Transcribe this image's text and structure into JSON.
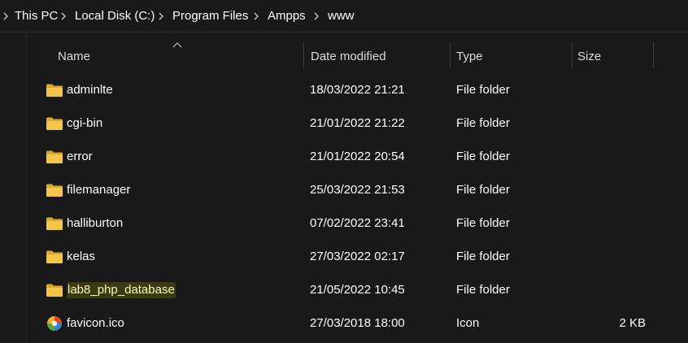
{
  "breadcrumb": {
    "items": [
      "This PC",
      "Local Disk (C:)",
      "Program Files",
      "Ampps",
      "www"
    ]
  },
  "columns": {
    "name": "Name",
    "date_modified": "Date modified",
    "type": "Type",
    "size": "Size",
    "sort_indicator": "sort-ascending-icon"
  },
  "files": [
    {
      "name": "adminlte",
      "date": "18/03/2022 21:21",
      "type": "File folder",
      "size": "",
      "icon": "folder-icon"
    },
    {
      "name": "cgi-bin",
      "date": "21/01/2022 21:22",
      "type": "File folder",
      "size": "",
      "icon": "folder-icon"
    },
    {
      "name": "error",
      "date": "21/01/2022 20:54",
      "type": "File folder",
      "size": "",
      "icon": "folder-icon"
    },
    {
      "name": "filemanager",
      "date": "25/03/2022 21:53",
      "type": "File folder",
      "size": "",
      "icon": "folder-icon"
    },
    {
      "name": "halliburton",
      "date": "07/02/2022 23:41",
      "type": "File folder",
      "size": "",
      "icon": "folder-icon"
    },
    {
      "name": "kelas",
      "date": "27/03/2022 02:17",
      "type": "File folder",
      "size": "",
      "icon": "folder-icon"
    },
    {
      "name": "lab8_php_database",
      "date": "21/05/2022 10:45",
      "type": "File folder",
      "size": "",
      "icon": "folder-icon",
      "highlighted": true
    },
    {
      "name": "favicon.ico",
      "date": "27/03/2018 18:00",
      "type": "Icon",
      "size": "2 KB",
      "icon": "ampps-icon"
    }
  ],
  "colors": {
    "background": "#191919",
    "folder": "#f3c549",
    "highlight": "#fffbb0"
  }
}
